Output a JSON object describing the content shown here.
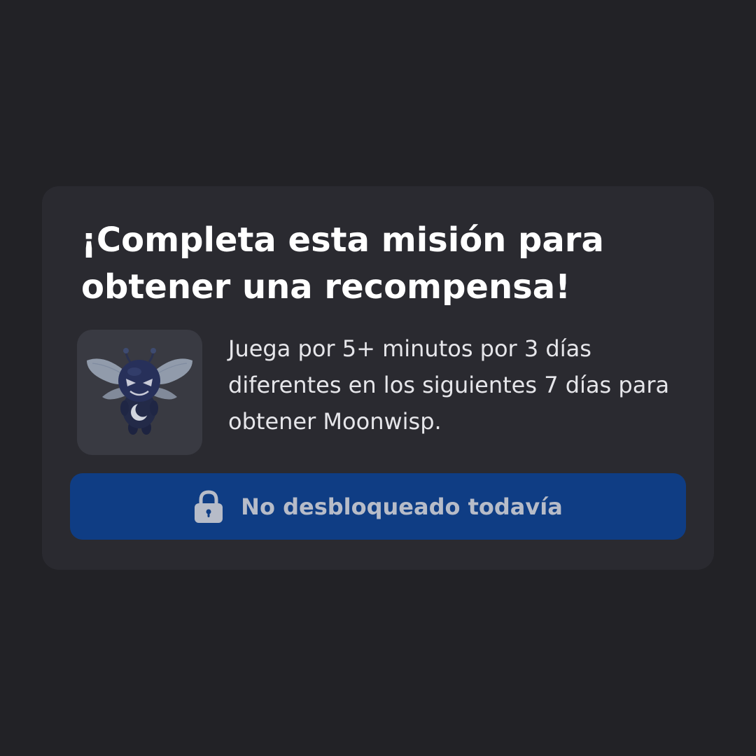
{
  "mission": {
    "title": "¡Completa esta misión para obtener una recompensa!",
    "description": "Juega por 5+ minutos por 3 días diferentes en los siguientes 7 días para obtener Moonwisp.",
    "reward_icon": "moonwisp-creature-icon",
    "status_button": {
      "label": "No desbloqueado todavía",
      "icon": "lock-icon"
    }
  },
  "colors": {
    "background": "#222226",
    "card": "#2a2a30",
    "thumbnail": "#393a42",
    "button": "#0f3d84",
    "button_text": "#b7bcc8",
    "title_text": "#ffffff",
    "body_text": "#e6e6ea"
  }
}
